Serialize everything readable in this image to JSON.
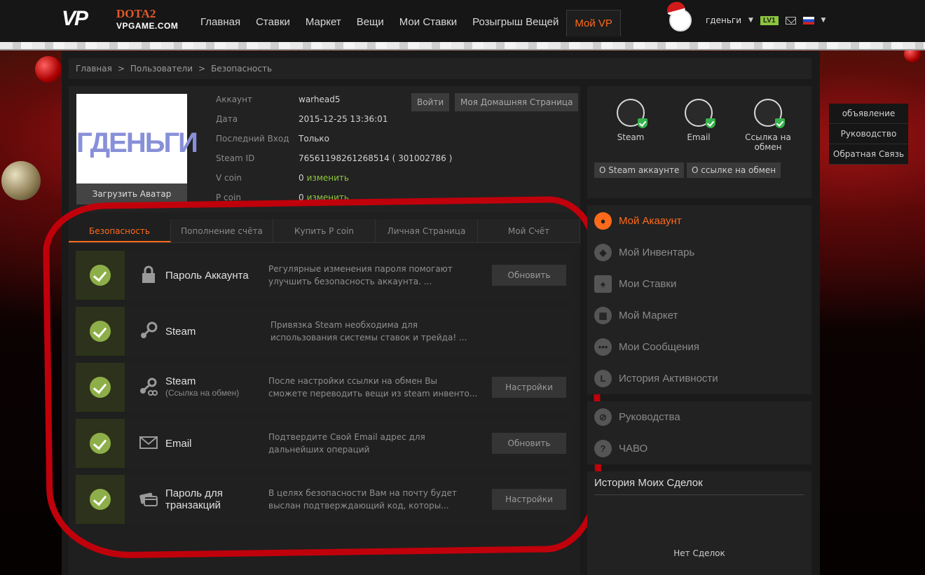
{
  "logo": {
    "vp": "VP",
    "dota": "DOTA2",
    "site": "VPGAME.COM"
  },
  "nav": [
    {
      "label": "Главная"
    },
    {
      "label": "Ставки"
    },
    {
      "label": "Маркет"
    },
    {
      "label": "Вещи"
    },
    {
      "label": "Мои Ставки"
    },
    {
      "label": "Розыгрыш Вещей"
    },
    {
      "label": "Мой VP"
    }
  ],
  "user": {
    "name": "гденьги",
    "level": "LV1"
  },
  "breadcrumb": [
    "Главная",
    ">",
    "Пользователи",
    ">",
    "Безопасность"
  ],
  "profile": {
    "avatar_text": "ГДЕНЬГИ",
    "upload_label": "Загрузить Аватар",
    "login_button": "Войти",
    "home_button": "Моя Домашняя Страница",
    "fields": [
      {
        "label": "Аккаунт",
        "value": "warhead5",
        "link": ""
      },
      {
        "label": "Дата",
        "value": "2015-12-25 13:36:01",
        "link": ""
      },
      {
        "label": "Последний Вход",
        "value": "Только",
        "link": ""
      },
      {
        "label": "Steam ID",
        "value": "76561198261268514 ( 301002786 )",
        "link": ""
      },
      {
        "label": "V coin",
        "value": "0",
        "link": "изменить"
      },
      {
        "label": "P coin",
        "value": "0",
        "link": "изменить"
      }
    ]
  },
  "tabs": [
    {
      "label": "Безопасность"
    },
    {
      "label": "Пополнение счёта"
    },
    {
      "label": "Купить P coin"
    },
    {
      "label": "Личная Страница"
    },
    {
      "label": "Мой Счёт"
    }
  ],
  "security": [
    {
      "title": "Пароль Аккаунта",
      "subtitle": "",
      "icon": "lock-icon",
      "desc": "Регулярные изменения пароля помогают улучшить безопасность аккаунта. ...",
      "button": "Обновить"
    },
    {
      "title": "Steam",
      "subtitle": "",
      "icon": "steam-icon",
      "desc": "Привязка Steam необходима для использования системы ставок и трейда! ...",
      "button": ""
    },
    {
      "title": "Steam",
      "subtitle": "(Ссылка на обмен)",
      "icon": "steam-link-icon",
      "desc": "После настройки ссылки на обмен Вы сможете переводить вещи из steam инвенто...",
      "button": "Настройки"
    },
    {
      "title": "Email",
      "subtitle": "",
      "icon": "email-icon",
      "desc": "Подтвердите Свой Email адрес для дальнейших операций",
      "button": "Обновить"
    },
    {
      "title": "Пароль для транзакций",
      "subtitle": "",
      "icon": "card-icon",
      "desc": "В целях безопасности Вам на почту будет выслан подтверждающий код, которы...",
      "button": "Настройки"
    }
  ],
  "verify": {
    "items": [
      {
        "label": "Steam"
      },
      {
        "label": "Email"
      },
      {
        "label": "Ссылка на обмен"
      }
    ],
    "steam_button": "О Steam аккаунте",
    "trade_button": "О ссылке на обмен"
  },
  "side_notice": [
    "объявление",
    "Руководство",
    "Обратная Связь"
  ],
  "menu": [
    {
      "label": "Мой Акааунт",
      "icon": "user-icon"
    },
    {
      "label": "Мой Инвентарь",
      "icon": "dropbox-icon"
    },
    {
      "label": "Мои Ставки",
      "icon": "cards-icon"
    },
    {
      "label": "Мой Маркет",
      "icon": "basket-icon"
    },
    {
      "label": "Мои Сообщения",
      "icon": "chat-icon"
    },
    {
      "label": "История Активности",
      "icon": "history-icon"
    }
  ],
  "menu2": [
    {
      "label": "Руководства",
      "icon": "compass-icon"
    },
    {
      "label": "ЧАВО",
      "icon": "question-icon"
    }
  ],
  "history": {
    "title": "История Моих Сделок",
    "empty": "Нет Сделок"
  },
  "colors": {
    "accent": "#ff6a1a",
    "verified": "#8cc63f",
    "annotation": "#c0000b"
  }
}
